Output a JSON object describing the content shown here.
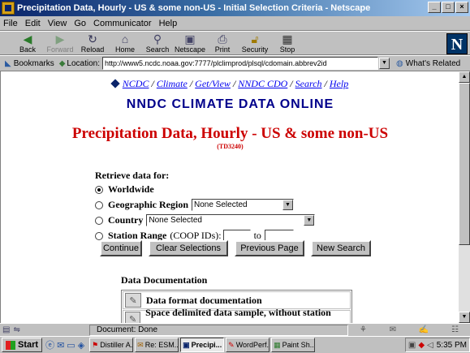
{
  "window": {
    "title": "Precipitation Data, Hourly - US & some non-US - Initial Selection Criteria - Netscape",
    "controls": [
      "_",
      "□",
      "×"
    ]
  },
  "menu": [
    "File",
    "Edit",
    "View",
    "Go",
    "Communicator",
    "Help"
  ],
  "toolbar": [
    {
      "label": "Back",
      "icon": "back-arrow-icon",
      "enabled": true
    },
    {
      "label": "Forward",
      "icon": "forward-arrow-icon",
      "enabled": false
    },
    {
      "label": "Reload",
      "icon": "reload-icon",
      "enabled": true
    },
    {
      "label": "Home",
      "icon": "home-icon",
      "enabled": true
    },
    {
      "label": "Search",
      "icon": "search-icon",
      "enabled": true
    },
    {
      "label": "Netscape",
      "icon": "netscape-icon",
      "enabled": true
    },
    {
      "label": "Print",
      "icon": "print-icon",
      "enabled": true
    },
    {
      "label": "Security",
      "icon": "lock-icon",
      "enabled": true
    },
    {
      "label": "Stop",
      "icon": "stop-icon",
      "enabled": true
    }
  ],
  "location": {
    "bookmarks_label": "Bookmarks",
    "location_label": "Location:",
    "url": "http://www5.ncdc.noaa.gov:7777/plclimprod/plsql/cdomain.abbrev2id",
    "related_label": "What's Related"
  },
  "page": {
    "nav": [
      "NCDC",
      "Climate",
      "Get/View",
      "NNDC CDO",
      "Search",
      "Help"
    ],
    "site_title": "NNDC CLIMATE DATA ONLINE",
    "title": "Precipitation Data, Hourly - US & some non-US",
    "dataset_code": "(TD3240)",
    "retrieve_label": "Retrieve data for:",
    "options": {
      "worldwide": "Worldwide",
      "region": "Geographic Region",
      "region_value": "None Selected",
      "country": "Country",
      "country_value": "None Selected",
      "station_range": "Station Range",
      "station_range_note": "(COOP IDs):",
      "to_label": "to"
    },
    "buttons": [
      "Continue",
      "Clear Selections",
      "Previous Page",
      "New Search"
    ],
    "docs_heading": "Data Documentation",
    "docs": [
      "Data format documentation",
      "Space delimited data sample, without station names"
    ]
  },
  "status": {
    "text": "Document: Done"
  },
  "taskbar": {
    "start": "Start",
    "tasks": [
      "Distiller A...",
      "Re: ESM...",
      "Precipi...",
      "WordPerf...",
      "Paint Sh..."
    ],
    "active_task": 2,
    "clock": "5:35 PM"
  }
}
